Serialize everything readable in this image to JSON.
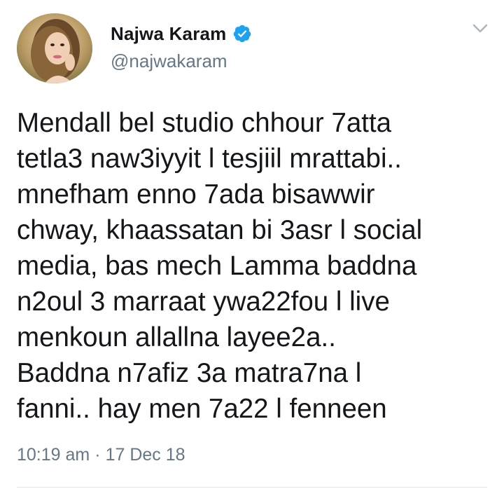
{
  "author": {
    "display_name": "Najwa Karam",
    "handle": "@najwakaram",
    "verified": true,
    "avatar_icon": "profile-photo"
  },
  "tweet": {
    "lines": [
      "Mendall bel studio chhour 7atta",
      "tetla3 naw3iyyit l tesjiil mrattabi..",
      "mnefham enno 7ada bisawwir",
      "chway, khaassatan bi 3asr l social",
      "media, bas mech Lamma baddna",
      "n2oul 3 marraat ywa22fou l live",
      "menkoun allallna layee2a..",
      "Baddna n7afiz 3a matra7na l",
      "fanni.. hay men 7a22 l fenneen"
    ]
  },
  "meta": {
    "time": "10:19 am",
    "separator": "·",
    "date": "17 Dec 18"
  },
  "icons": {
    "verified": "verified-badge-icon",
    "menu": "chevron-down-icon"
  },
  "colors": {
    "text": "#14171a",
    "secondary": "#657786",
    "verified": "#1da1f2",
    "divider": "#e1e8ed"
  }
}
